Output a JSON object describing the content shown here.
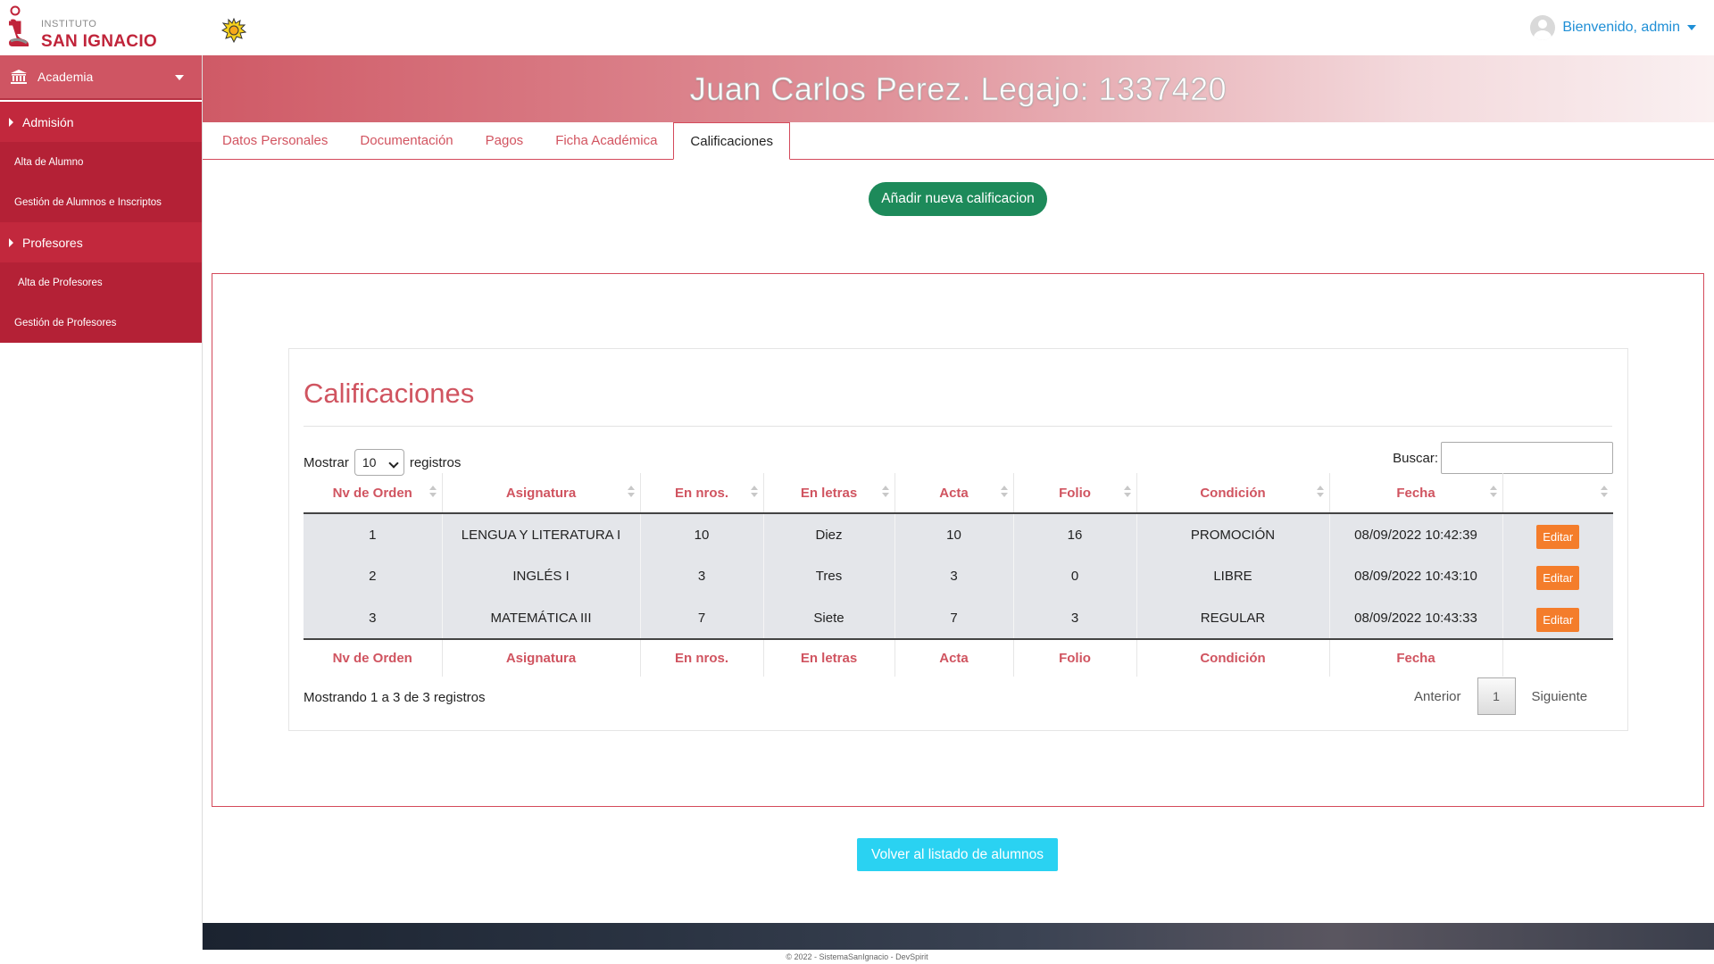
{
  "brand": {
    "small": "INSTITUTO",
    "big": "SAN IGNACIO",
    "accent_color": "#c0243a"
  },
  "user": {
    "greeting": "Bienvenido, admin"
  },
  "sidebar": {
    "academia": "Academia",
    "items": [
      {
        "label": "Admisión",
        "type": "section"
      },
      {
        "label": "Alta de Alumno",
        "type": "link"
      },
      {
        "label": "Gestión de Alumnos e Inscriptos",
        "type": "link"
      },
      {
        "label": "Profesores",
        "type": "section"
      },
      {
        "label": "Alta de Profesores",
        "type": "link"
      },
      {
        "label": "Gestión de Profesores",
        "type": "link"
      }
    ]
  },
  "banner": {
    "title": "Juan Carlos Perez. Legajo: 1337420"
  },
  "tabs": [
    {
      "label": "Datos Personales",
      "active": false
    },
    {
      "label": "Documentación",
      "active": false
    },
    {
      "label": "Pagos",
      "active": false
    },
    {
      "label": "Ficha Académica",
      "active": false
    },
    {
      "label": "Calificaciones",
      "active": true
    }
  ],
  "actions": {
    "add_label": "Añadir nueva calificacion",
    "back_label": "Volver al listado de alumnos"
  },
  "card": {
    "title": "Calificaciones",
    "show_prefix": "Mostrar",
    "show_value": "10",
    "show_suffix": "registros",
    "search_label": "Buscar:",
    "search_value": ""
  },
  "table": {
    "columns": [
      "Nv de Orden",
      "Asignatura",
      "En nros.",
      "En letras",
      "Acta",
      "Folio",
      "Condición",
      "Fecha",
      ""
    ],
    "rows": [
      [
        "1",
        "LENGUA Y LITERATURA I",
        "10",
        "Diez",
        "10",
        "16",
        "PROMOCIÓN",
        "08/09/2022 10:42:39"
      ],
      [
        "2",
        "INGLÉS I",
        "3",
        "Tres",
        "3",
        "0",
        "LIBRE",
        "08/09/2022 10:43:10"
      ],
      [
        "3",
        "MATEMÁTICA III",
        "7",
        "Siete",
        "7",
        "3",
        "REGULAR",
        "08/09/2022 10:43:33"
      ]
    ],
    "edit_label": "Editar"
  },
  "pagination": {
    "info": "Mostrando 1 a 3 de 3 registros",
    "prev": "Anterior",
    "current": "1",
    "next": "Siguiente"
  },
  "footer": {
    "text": "© 2022 - SistemaSanIgnacio - DevSpirit"
  }
}
